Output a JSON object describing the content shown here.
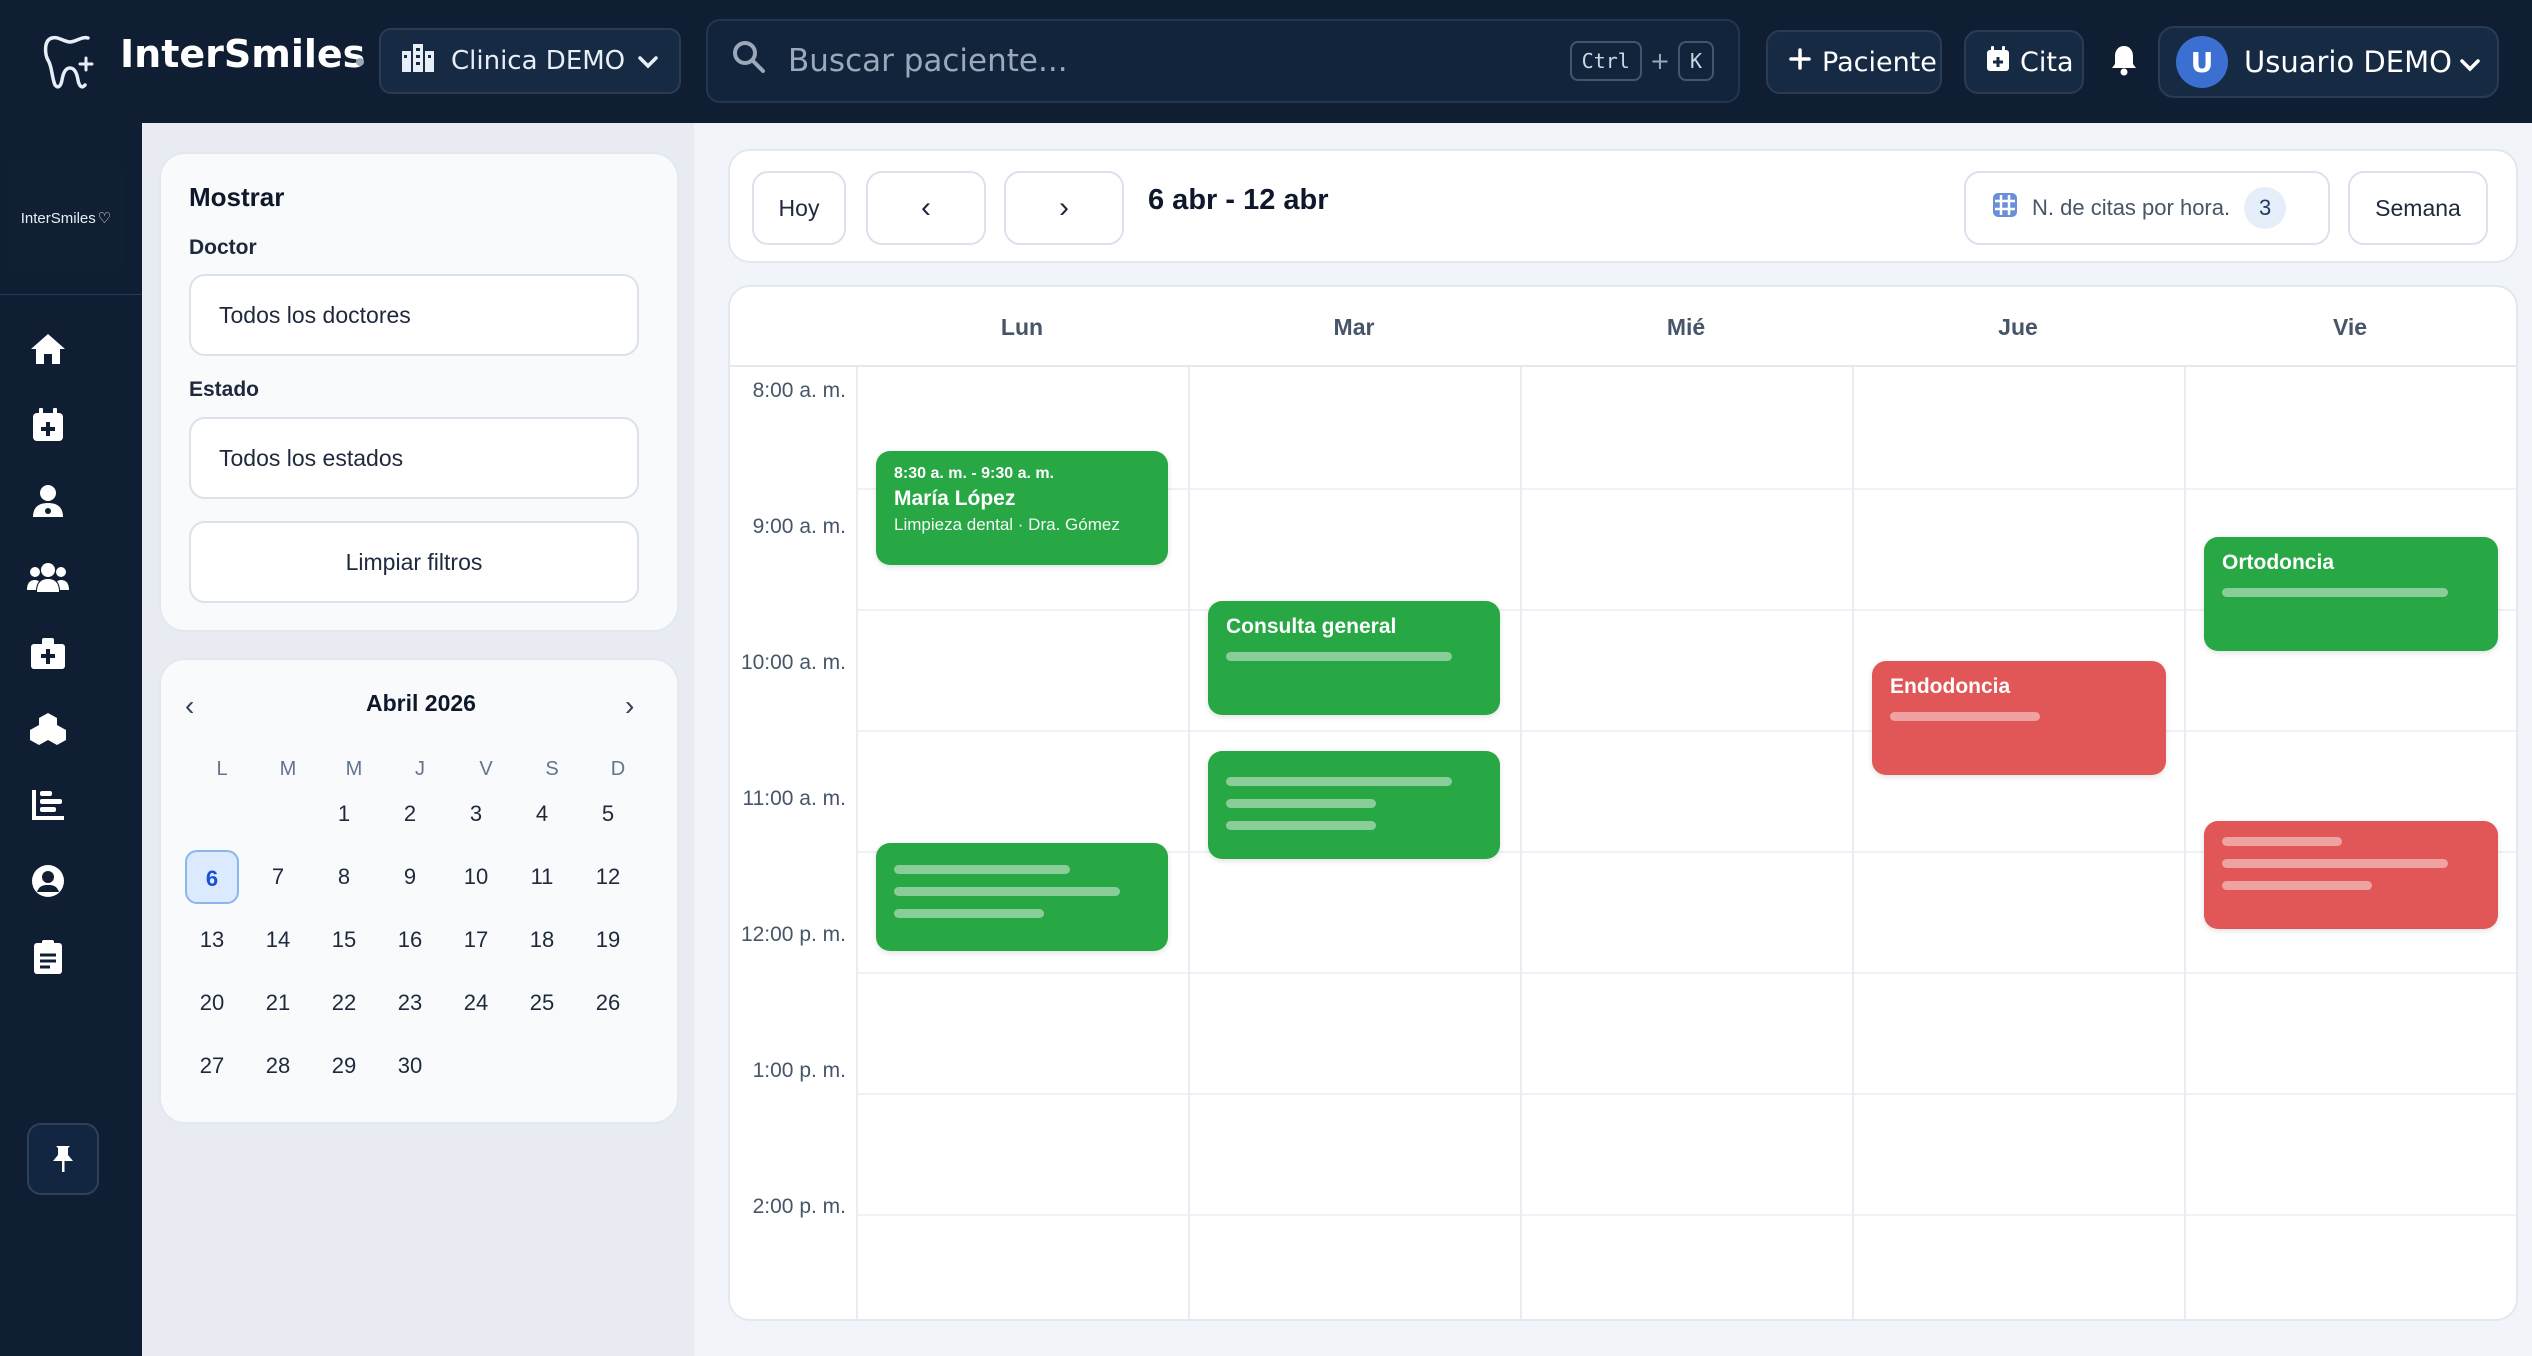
{
  "topbar": {
    "brand": "InterSmiles",
    "clinic": "Clinica DEMO",
    "search_placeholder": "Buscar paciente...",
    "shortcut_key1": "Ctrl",
    "shortcut_plus": "+",
    "shortcut_key2": "K",
    "new_patient": "Paciente",
    "new_appointment": "Cita",
    "user_initial": "U",
    "user_name": "Usuario DEMO"
  },
  "sidebar": {
    "mini_logo": "InterSmiles",
    "icons": [
      "home-icon",
      "calendar-add-icon",
      "doctor-icon",
      "patients-icon",
      "clinic-icon",
      "cubes-icon",
      "chart-icon",
      "user-circle-icon",
      "document-icon"
    ],
    "pin_icon": "pin-icon"
  },
  "filters": {
    "title": "Mostrar",
    "doctor_label": "Doctor",
    "doctor_value": "Todos los doctores",
    "status_label": "Estado",
    "status_value": "Todos los estados",
    "clear": "Limpiar filtros"
  },
  "mini_calendar": {
    "prev": "‹",
    "next": "›",
    "title": "Abril 2026",
    "weekdays": [
      "L",
      "M",
      "M",
      "J",
      "V",
      "S",
      "D"
    ],
    "days": [
      "1",
      "2",
      "3",
      "4",
      "5",
      "6",
      "7",
      "8",
      "9",
      "10",
      "11",
      "12",
      "13",
      "14",
      "15",
      "16",
      "17",
      "18",
      "19",
      "20",
      "21",
      "22",
      "23",
      "24",
      "25",
      "26",
      "27",
      "28",
      "29",
      "30"
    ],
    "selected": "6"
  },
  "toolbar": {
    "today": "Hoy",
    "prev": "‹",
    "next": "›",
    "range": "6 abr - 12 abr",
    "per_hour_label": "N. de citas por hora.",
    "per_hour_value": "3",
    "view": "Semana"
  },
  "calendar": {
    "days": [
      "Lun",
      "Mar",
      "Mié",
      "Jue",
      "Vie"
    ],
    "times": [
      "8:00 a. m.",
      "9:00 a. m.",
      "10:00 a. m.",
      "11:00 a. m.",
      "12:00 p. m.",
      "1:00 p. m.",
      "2:00 p. m."
    ],
    "events": [
      {
        "day": "Lun",
        "status": "green",
        "time": "8:30 a. m. - 9:30 a. m.",
        "name": "María López",
        "desc": "Limpieza dental · Dra. Gómez"
      },
      {
        "day": "Mar",
        "status": "green",
        "title": "Consulta general"
      },
      {
        "day": "Mar",
        "status": "green"
      },
      {
        "day": "Lun",
        "status": "green"
      },
      {
        "day": "Jue",
        "status": "red",
        "title": "Endodoncia"
      },
      {
        "day": "Vie",
        "status": "green",
        "title": "Ortodoncia"
      },
      {
        "day": "Vie",
        "status": "red"
      }
    ],
    "colors": {
      "green": "#28a745",
      "red": "#e15656"
    }
  }
}
